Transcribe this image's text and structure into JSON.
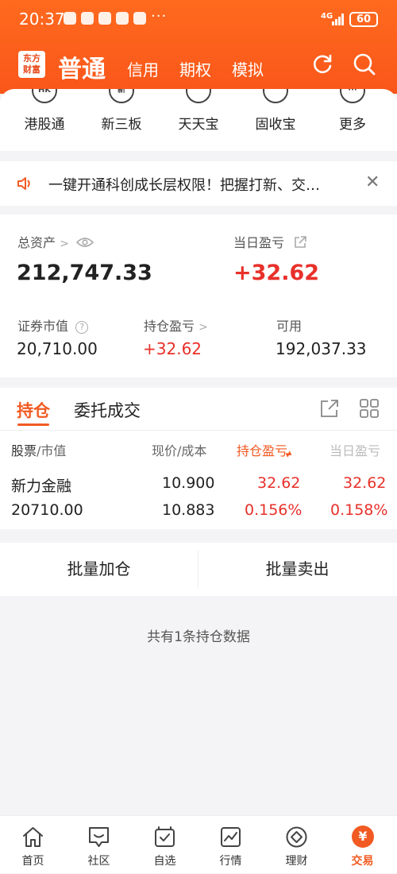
{
  "status": {
    "time": "20:37",
    "dots": "···",
    "network": "4G",
    "battery": "60"
  },
  "nav": {
    "logo": "东方\n财富",
    "tabs": [
      "普通",
      "信用",
      "期权",
      "模拟"
    ]
  },
  "shortcuts": [
    {
      "label": "港股通",
      "icon_text": "HK"
    },
    {
      "label": "新三板",
      "icon_text": "新"
    },
    {
      "label": "天天宝",
      "icon_text": ""
    },
    {
      "label": "固收宝",
      "icon_text": ""
    },
    {
      "label": "更多",
      "icon_text": "···"
    }
  ],
  "notice": {
    "text": "一键开通科创成长层权限！把握打新、交…"
  },
  "assets": {
    "total_label": "总资产",
    "total_value": "212,747.33",
    "daily_label": "当日盈亏",
    "daily_value": "+32.62",
    "market_label": "证券市值",
    "market_value": "20,710.00",
    "position_label": "持仓盈亏",
    "position_value": "+32.62",
    "available_label": "可用",
    "available_value": "192,037.33"
  },
  "holdings": {
    "tab_positions": "持仓",
    "tab_orders": "委托成交",
    "headers": {
      "stock": "股票",
      "market": "/市值",
      "price": "现价/成本",
      "position_pl": "持仓盈亏",
      "daily_pl": "当日盈亏"
    },
    "rows": [
      {
        "name": "新力金融",
        "market_value": "20710.00",
        "price": "10.900",
        "cost": "10.883",
        "position_pl": "32.62",
        "position_pl_pct": "0.156%",
        "daily_pl": "32.62",
        "daily_pl_pct": "0.158%"
      }
    ]
  },
  "batch": {
    "add": "批量加仓",
    "sell": "批量卖出"
  },
  "summary": "共有1条持仓数据",
  "bottom_nav": [
    {
      "label": "首页",
      "icon": "home-icon"
    },
    {
      "label": "社区",
      "icon": "community-icon"
    },
    {
      "label": "自选",
      "icon": "watchlist-icon"
    },
    {
      "label": "行情",
      "icon": "market-icon"
    },
    {
      "label": "理财",
      "icon": "wealth-icon"
    },
    {
      "label": "交易",
      "icon": "trade-icon"
    }
  ],
  "colors": {
    "brand": "#f15a22",
    "up": "#e8302a"
  }
}
